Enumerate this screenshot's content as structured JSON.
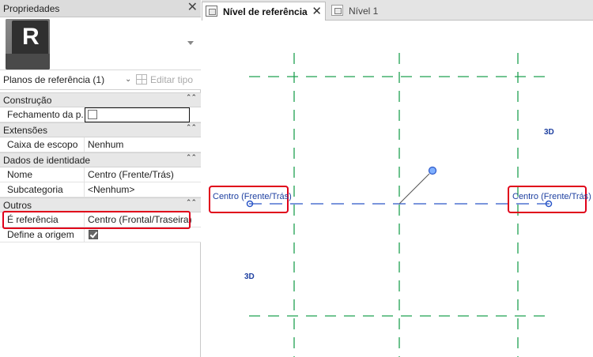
{
  "properties_panel": {
    "title": "Propriedades",
    "close_glyph": "✕",
    "type_selector_icon": "revit-r-icon",
    "type_selector_letter": "R",
    "filter_value": "Planos de referência (1)",
    "edit_type_label": "Editar tipo",
    "groups": [
      {
        "label": "Construção",
        "collapse_glyph": "⌃⌃"
      },
      {
        "label": "Extensões",
        "collapse_glyph": "⌃⌃"
      },
      {
        "label": "Dados de identidade",
        "collapse_glyph": "⌃⌃"
      },
      {
        "label": "Outros",
        "collapse_glyph": "⌃⌃"
      }
    ],
    "rows": {
      "fechamento": {
        "label": "Fechamento da p...",
        "checked": false
      },
      "caixa_escopo": {
        "label": "Caixa de escopo",
        "value": "Nenhum"
      },
      "nome": {
        "label": "Nome",
        "value": "Centro (Frente/Trás)"
      },
      "subcategoria": {
        "label": "Subcategoria",
        "value": "<Nenhum>"
      },
      "e_referencia": {
        "label": "É referência",
        "value": "Centro (Frontal/Traseira)"
      },
      "define_origem": {
        "label": "Define a origem",
        "checked": true
      }
    }
  },
  "view_tabs": [
    {
      "label": "Nível de referência",
      "active": true,
      "close_glyph": "✕"
    },
    {
      "label": "Nível 1",
      "active": false
    }
  ],
  "canvas": {
    "label_3d": "3D",
    "plane_label_left": "Centro (Frente/Trás)",
    "plane_label_right": "Centro (Frente/Trás)"
  },
  "colors": {
    "reference_plane_green": "#1ea050",
    "reference_plane_blue": "#2a56c8",
    "highlight_red": "#e0001a",
    "label_blue": "#1d3fa0"
  }
}
